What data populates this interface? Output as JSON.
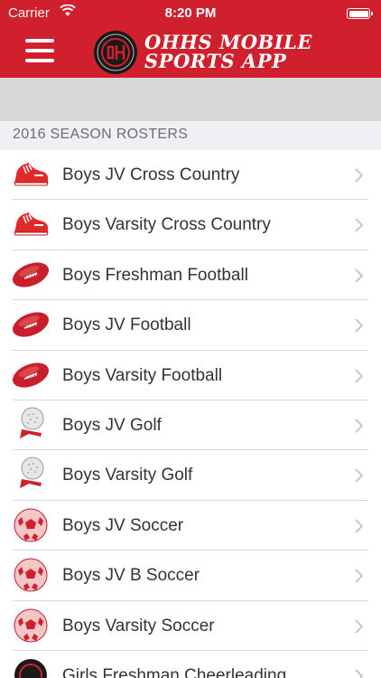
{
  "status": {
    "carrier": "Carrier",
    "time": "8:20 PM"
  },
  "nav": {
    "title_line1": "OHHS MOBILE",
    "title_line2": "SPORTS APP"
  },
  "section_header": "2016 SEASON ROSTERS",
  "rows": [
    {
      "label": "Boys JV Cross Country",
      "icon": "running-shoe-icon"
    },
    {
      "label": "Boys Varsity Cross Country",
      "icon": "running-shoe-icon"
    },
    {
      "label": "Boys Freshman Football",
      "icon": "football-icon"
    },
    {
      "label": "Boys JV Football",
      "icon": "football-icon"
    },
    {
      "label": "Boys Varsity Football",
      "icon": "football-icon"
    },
    {
      "label": "Boys JV Golf",
      "icon": "golf-ball-tee-icon"
    },
    {
      "label": "Boys Varsity Golf",
      "icon": "golf-ball-tee-icon"
    },
    {
      "label": "Boys JV Soccer",
      "icon": "soccer-ball-icon"
    },
    {
      "label": "Boys JV B Soccer",
      "icon": "soccer-ball-icon"
    },
    {
      "label": "Boys Varsity Soccer",
      "icon": "soccer-ball-icon"
    },
    {
      "label": "Girls Freshman Cheerleading",
      "icon": "school-seal-icon"
    }
  ],
  "colors": {
    "brand_red": "#d0202e",
    "separator": "#d9d9d9",
    "section_bg": "#efeff4"
  }
}
